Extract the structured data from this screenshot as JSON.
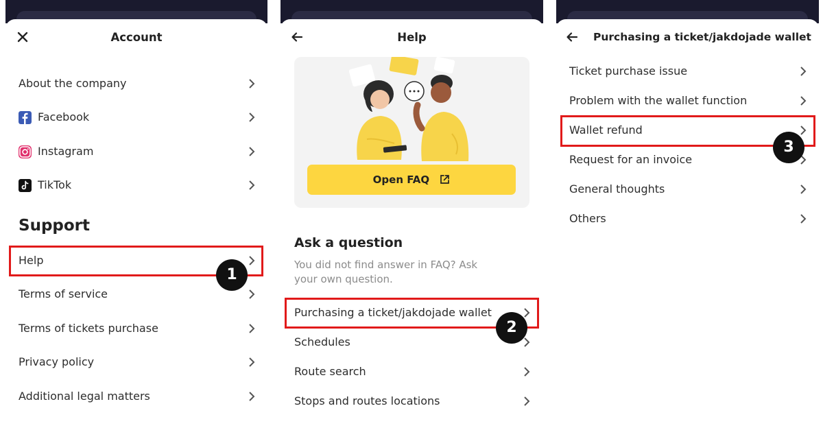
{
  "panel1": {
    "title": "Account",
    "items": [
      {
        "label": "About the company"
      },
      {
        "label": "Facebook"
      },
      {
        "label": "Instagram"
      },
      {
        "label": "TikTok"
      }
    ],
    "section": "Support",
    "support_items": [
      {
        "label": "Help"
      },
      {
        "label": "Terms of service"
      },
      {
        "label": "Terms of tickets purchase"
      },
      {
        "label": "Privacy policy"
      },
      {
        "label": "Additional legal matters"
      }
    ],
    "badge": "1"
  },
  "panel2": {
    "title": "Help",
    "faq_button": "Open FAQ",
    "section": "Ask a question",
    "hint": "You did not find answer in FAQ? Ask your own question.",
    "items": [
      {
        "label": "Purchasing a ticket/jakdojade wallet"
      },
      {
        "label": "Schedules"
      },
      {
        "label": "Route search"
      },
      {
        "label": "Stops and routes locations"
      }
    ],
    "badge": "2"
  },
  "panel3": {
    "title": "Purchasing a ticket/jakdojade wallet",
    "items": [
      {
        "label": "Ticket purchase issue"
      },
      {
        "label": "Problem with the wallet function"
      },
      {
        "label": "Wallet refund"
      },
      {
        "label": "Request for an invoice"
      },
      {
        "label": "General thoughts"
      },
      {
        "label": "Others"
      }
    ],
    "badge": "3"
  },
  "colors": {
    "highlight": "#e11a1a",
    "faq_button": "#fdd640",
    "dark_bar": "#1a1a2e",
    "badge": "#111111"
  },
  "icons": [
    "close-icon",
    "back-arrow-icon",
    "chevron-right-icon",
    "facebook-icon",
    "instagram-icon",
    "tiktok-icon",
    "external-link-icon"
  ]
}
